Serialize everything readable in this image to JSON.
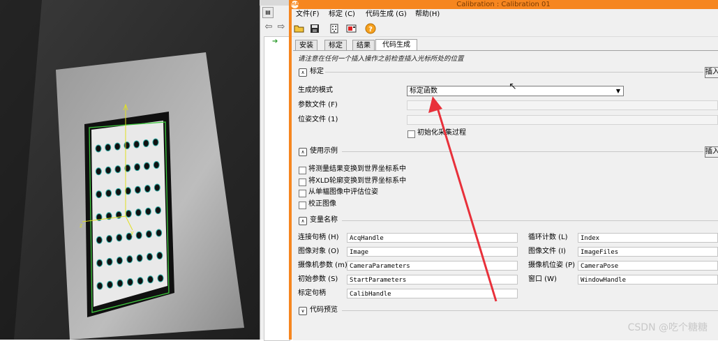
{
  "titlebar": {
    "title": "Calibration : Calibration 01",
    "app_badge": "HA"
  },
  "menu": [
    "文件(F)",
    "标定 (C)",
    "代码生成 (G)",
    "帮助(H)"
  ],
  "tabs": [
    "安装",
    "标定",
    "结果",
    "代码生成"
  ],
  "active_tab": 3,
  "hint": "请注意在任何一个插入操作之前检查插入光标所处的位置",
  "sections": {
    "calib": {
      "title": "标定",
      "insert": "插入"
    },
    "usage": {
      "title": "使用示例",
      "insert": "插入"
    },
    "varnames": {
      "title": "变量名称"
    },
    "preview": {
      "title": "代码预览"
    }
  },
  "calib_form": {
    "mode_label": "生成的模式",
    "mode_value": "标定函数",
    "param_file_label": "参数文件 (F)",
    "param_file_value": "",
    "pose_file_label": "位姿文件 (1)",
    "pose_file_value": "",
    "init_checkbox": "初始化采集过程"
  },
  "usage_options": [
    "将测量结果变换到世界坐标系中",
    "将XLD轮廓变换到世界坐标系中",
    "从单幅图像中评估位姿",
    "校正图像"
  ],
  "variables_left": [
    {
      "label": "连接句柄 (H)",
      "value": "AcqHandle"
    },
    {
      "label": "图像对象 (O)",
      "value": "Image"
    },
    {
      "label": "摄像机参数 (m)",
      "value": "CameraParameters"
    },
    {
      "label": "初始参数 (S)",
      "value": "StartParameters"
    },
    {
      "label": "标定句柄",
      "value": "CalibHandle"
    }
  ],
  "variables_right": [
    {
      "label": "循环计数 (L)",
      "value": "Index"
    },
    {
      "label": "图像文件 (I)",
      "value": "ImageFiles"
    },
    {
      "label": "摄像机位姿 (P)",
      "value": "CameraPose"
    },
    {
      "label": "窗口 (W)",
      "value": "WindowHandle"
    }
  ],
  "watermark": "CSDN @吃个糖糖",
  "colors": {
    "frame": "#f6861f",
    "annotation_arrow": "#e8303a",
    "target_outline": "#3fc83f",
    "axes": "#e0e020"
  },
  "icons": {
    "toolbar": [
      "open-folder-icon",
      "save-icon",
      "calibration-board-icon",
      "camera-capture-icon",
      "help-icon"
    ],
    "nav": [
      "back-arrow-icon",
      "forward-arrow-icon"
    ]
  }
}
